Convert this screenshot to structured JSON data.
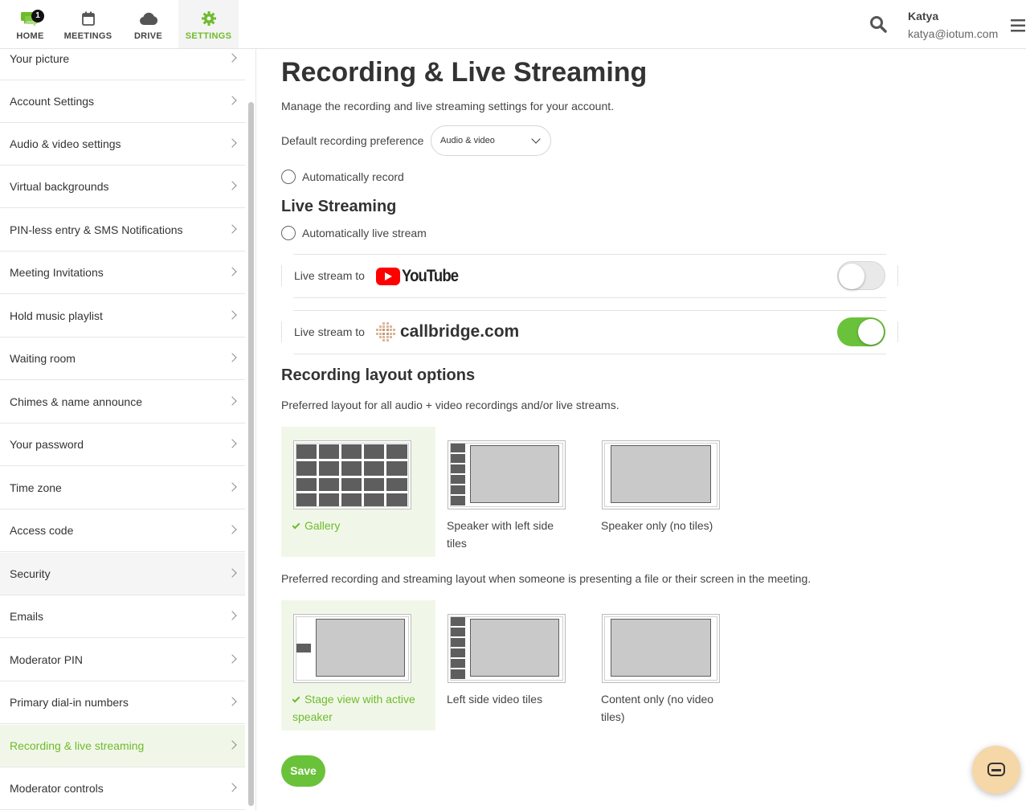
{
  "nav": {
    "items": [
      {
        "label": "HOME",
        "badge": "1",
        "icon": "chat-bubbles-icon"
      },
      {
        "label": "MEETINGS",
        "icon": "calendar-icon"
      },
      {
        "label": "DRIVE",
        "icon": "cloud-icon"
      },
      {
        "label": "SETTINGS",
        "icon": "gear-icon",
        "active": true
      }
    ]
  },
  "user": {
    "name": "Katya",
    "email": "katya@iotum.com"
  },
  "colors": {
    "accent": "#6ebb2c",
    "toggle_on": "#6ac23a",
    "chat": "#f6d7a8"
  },
  "sidebar": {
    "items": [
      {
        "label": "Your picture"
      },
      {
        "label": "Account Settings"
      },
      {
        "label": "Audio & video settings"
      },
      {
        "label": "Virtual backgrounds"
      },
      {
        "label": "PIN-less entry & SMS Notifications"
      },
      {
        "label": "Meeting Invitations"
      },
      {
        "label": "Hold music playlist"
      },
      {
        "label": "Waiting room"
      },
      {
        "label": "Chimes & name announce"
      },
      {
        "label": "Your password"
      },
      {
        "label": "Time zone"
      },
      {
        "label": "Access code"
      },
      {
        "label": "Security"
      },
      {
        "label": "Emails"
      },
      {
        "label": "Moderator PIN"
      },
      {
        "label": "Primary dial-in numbers"
      },
      {
        "label": "Recording & live streaming",
        "active": true
      },
      {
        "label": "Moderator controls"
      }
    ]
  },
  "main": {
    "title": "Recording & Live Streaming",
    "description": "Manage the recording and live streaming settings for your account.",
    "default_pref_label": "Default recording preference",
    "default_pref_value": "Audio & video",
    "auto_record_label": "Automatically record",
    "live_streaming_title": "Live Streaming",
    "auto_live_label": "Automatically live stream",
    "youtube": {
      "label": "Live stream to",
      "brand": "YouTube",
      "enabled": false
    },
    "callbridge": {
      "label": "Live stream to",
      "brand": "callbridge.com",
      "enabled": true
    },
    "layout_title": "Recording layout options",
    "layout_desc": "Preferred layout for all audio + video recordings and/or live streams.",
    "layouts": [
      {
        "label": "Gallery",
        "selected": true
      },
      {
        "label": "Speaker with left side tiles",
        "selected": false
      },
      {
        "label": "Speaker only (no tiles)",
        "selected": false
      }
    ],
    "present_desc": "Preferred recording and streaming layout when someone is presenting a file or their screen in the meeting.",
    "present_layouts": [
      {
        "label": "Stage view with active speaker",
        "selected": true
      },
      {
        "label": "Left side video tiles",
        "selected": false
      },
      {
        "label": "Content only (no video tiles)",
        "selected": false
      }
    ],
    "save_label": "Save"
  }
}
